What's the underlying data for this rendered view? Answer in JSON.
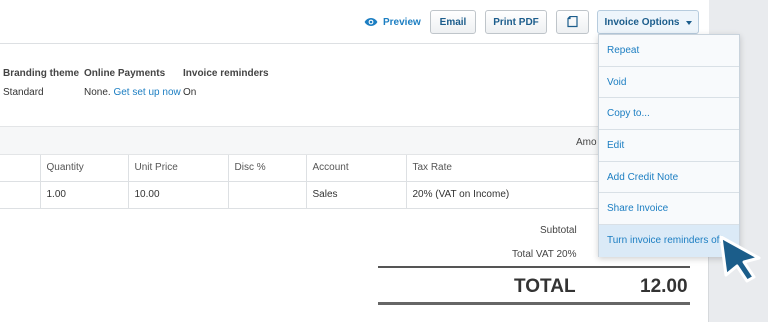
{
  "toolbar": {
    "preview_label": "Preview",
    "email_label": "Email",
    "print_label": "Print PDF",
    "options_label": "Invoice Options"
  },
  "details": [
    {
      "heading": "Branding theme",
      "value": "Standard"
    },
    {
      "heading": "Online Payments",
      "value": "None.",
      "link": "Get set up now"
    },
    {
      "heading": "Invoice reminders",
      "value": "On"
    }
  ],
  "amounts_label": "Amo",
  "table": {
    "headers": [
      "",
      "Quantity",
      "Unit Price",
      "Disc %",
      "Account",
      "Tax Rate"
    ],
    "rows": [
      [
        "",
        "1.00",
        "10.00",
        "",
        "Sales",
        "20% (VAT on Income)"
      ]
    ]
  },
  "totals": {
    "subtotal_label": "Subtotal",
    "vat_label": "Total VAT  20%",
    "total_label": "TOTAL",
    "total_value": "12.00"
  },
  "menu": {
    "items": [
      "Repeat",
      "Void",
      "Copy to...",
      "Edit",
      "Add Credit Note",
      "Share Invoice",
      "Turn invoice reminders off"
    ],
    "active_index": 6
  },
  "colors": {
    "link": "#1c7ec2",
    "cursor": "#1b5d8a"
  },
  "icons": {
    "preview": "eye-icon",
    "copy": "copy-icon",
    "options_caret": "caret-down-icon",
    "pointer": "mouse-pointer-icon"
  }
}
